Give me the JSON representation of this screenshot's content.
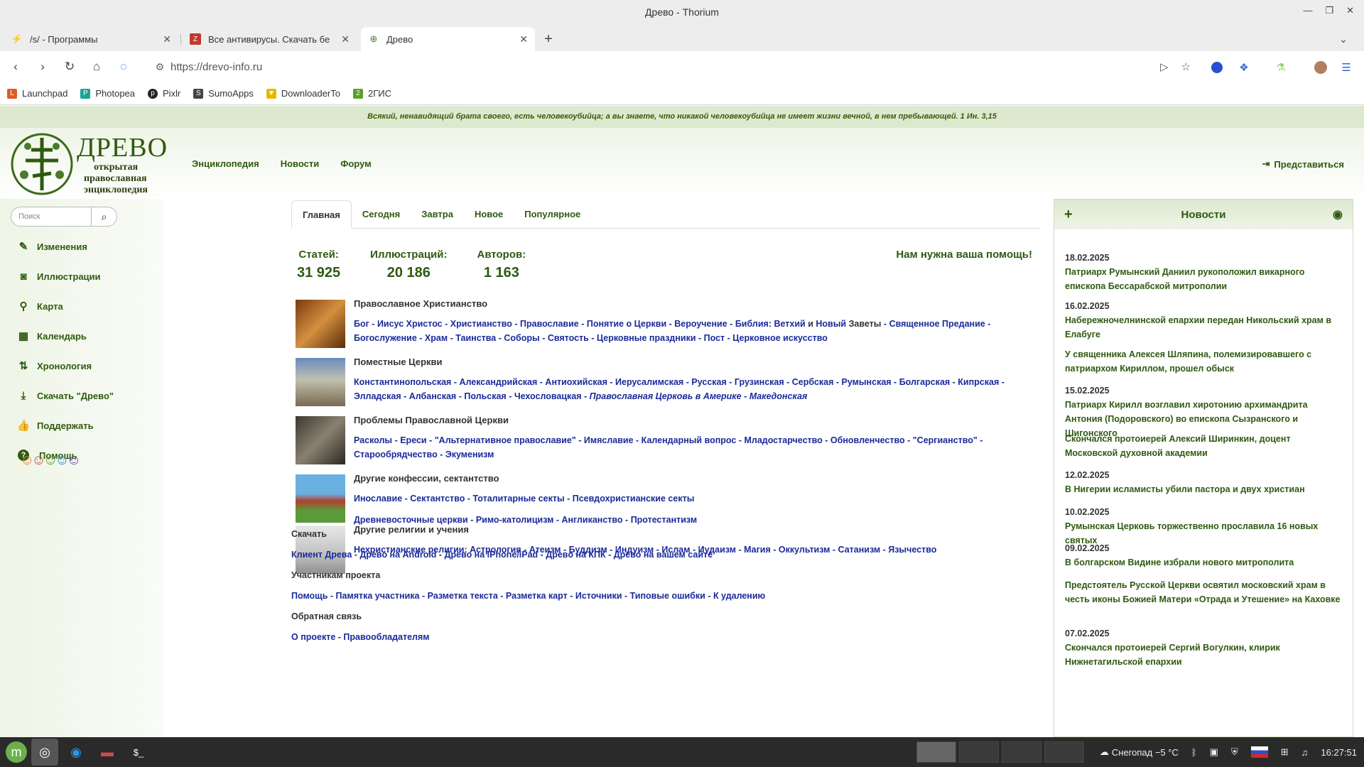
{
  "window": {
    "title": "Древо - Thorium"
  },
  "tabs": [
    {
      "label": "/s/ - Программы",
      "icon": "lightning-icon",
      "color": "#e8833a"
    },
    {
      "label": "Все антивирусы. Скачать бе",
      "icon": "antivirus-site-icon",
      "color": "#c0392b"
    },
    {
      "label": "Древо",
      "icon": "drevo-icon",
      "color": "#4a7a2a"
    }
  ],
  "url": "https://drevo-info.ru",
  "bookmarks": [
    {
      "label": "Launchpad",
      "color": "#e05a2a"
    },
    {
      "label": "Photopea",
      "color": "#18a497"
    },
    {
      "label": "Pixlr",
      "color": "#222"
    },
    {
      "label": "SumoApps",
      "color": "#333"
    },
    {
      "label": "DownloaderTo",
      "color": "#e6b800"
    },
    {
      "label": "2ГИС",
      "color": "#5aa02c"
    }
  ],
  "page": {
    "quote": "Всякий, ненавидящий брата своего, есть человекоубийца; а вы знаете, что никакой человекоубийца не имеет жизни вечной, в нем пребывающей. 1 Ин. 3,15",
    "logo": {
      "title": "ДРЕВО",
      "sub1": "открытая",
      "sub2": "православная",
      "sub3": "энциклопедия"
    },
    "nav": [
      "Энциклопедия",
      "Новости",
      "Форум"
    ],
    "login": "Представиться",
    "search_placeholder": "Поиск",
    "sidebar": [
      {
        "label": "Изменения",
        "icon": "pencil-icon"
      },
      {
        "label": "Иллюстрации",
        "icon": "camera-icon"
      },
      {
        "label": "Карта",
        "icon": "map-pin-icon"
      },
      {
        "label": "Календарь",
        "icon": "calendar-icon"
      },
      {
        "label": "Хронология",
        "icon": "sort-icon"
      },
      {
        "label": "Скачать \"Древо\"",
        "icon": "download-icon"
      },
      {
        "label": "Поддержать",
        "icon": "thumbs-up-icon"
      },
      {
        "label": "Помощь",
        "icon": "help-icon"
      }
    ],
    "main_tabs": [
      "Главная",
      "Сегодня",
      "Завтра",
      "Новое",
      "Популярное"
    ],
    "stats": [
      {
        "label": "Статей:",
        "value": "31 925"
      },
      {
        "label": "Иллюстраций:",
        "value": "20 186"
      },
      {
        "label": "Авторов:",
        "value": "1 163"
      }
    ],
    "help": "Нам нужна ваша помощь!",
    "sections": [
      {
        "title": "Православное Христианство",
        "links": [
          "Бог",
          "Иисус Христос",
          "Христианство",
          "Православие",
          "Понятие о Церкви",
          "Вероучение",
          "Библия: Ветхий",
          "и",
          "Новый",
          "Заветы",
          "Священное Предание",
          "Богослужение",
          "Храм",
          "Таинства",
          "Соборы",
          "Святость",
          "Церковные праздники",
          "Пост",
          "Церковное искусство"
        ]
      },
      {
        "title": "Поместные Церкви",
        "links": [
          "Константинопольская",
          "Александрийская",
          "Антиохийская",
          "Иерусалимская",
          "Русская",
          "Грузинская",
          "Сербская",
          "Румынская",
          "Болгарская",
          "Кипрская",
          "Элладская",
          "Албанская",
          "Польская",
          "Чехословацкая"
        ],
        "italic_links": [
          "Православная Церковь в Америке",
          "Македонская"
        ]
      },
      {
        "title": "Проблемы Православной Церкви",
        "links": [
          "Расколы",
          "Ереси",
          "\"Альтернативное православие\"",
          "Имяславие",
          "Календарный вопрос",
          "Младостарчество",
          "Обновленчество",
          "\"Сергианство\"",
          "Старообрядчество",
          "Экуменизм"
        ]
      },
      {
        "title": "Другие конфессии, сектантство",
        "links": [
          "Инославие",
          "Сектантство",
          "Тоталитарные секты",
          "Псевдохристианские секты"
        ],
        "links2": [
          "Древневосточные церкви",
          "Римо-католицизм",
          "Англиканство",
          "Протестантизм"
        ]
      },
      {
        "title": "Другие религии и учения",
        "links": [
          "Нехристианские религии:",
          "Астрология",
          "Атеизм",
          "Буддизм",
          "Индуизм",
          "Ислам",
          "Иудаизм",
          "Магия",
          "Оккультизм",
          "Сатанизм",
          "Язычество"
        ]
      }
    ],
    "lower": [
      {
        "title": "Скачать",
        "links": [
          "Клиент Древа",
          "Древо на Android",
          "Древо на iPhone/iPad",
          "Древо на КПК",
          "Древо на вашем сайте"
        ]
      },
      {
        "title": "Участникам проекта",
        "links": [
          "Помощь",
          "Памятка участника",
          "Разметка текста",
          "Разметка карт",
          "Источники",
          "Типовые ошибки",
          "К удалению"
        ]
      },
      {
        "title": "Обратная связь",
        "links": [
          "О проекте",
          "Правообладателям"
        ]
      }
    ],
    "news": {
      "title": "Новости",
      "items": [
        {
          "date": "18.02.2025",
          "text": "Патриарх Румынский Даниил рукоположил викарного епископа Бессарабской митрополии"
        },
        {
          "date": "16.02.2025",
          "text": "Набережночелнинской епархии передан Никольский храм в Елабуге"
        },
        {
          "date": "",
          "text": "У священника Алексея Шляпина, полемизировавшего с патриархом Кириллом, прошел обыск"
        },
        {
          "date": "15.02.2025",
          "text": "Патриарх Кирилл возглавил хиротонию архимандрита Антония (Подоровского) во епископа Сызранского и Шигонского"
        },
        {
          "date": "",
          "text": "Скончался протоиерей Алексий Ширинкин, доцент Московской духовной академии"
        },
        {
          "date": "12.02.2025",
          "text": "В Нигерии исламисты убили пастора и двух христиан"
        },
        {
          "date": "10.02.2025",
          "text": "Румынская Церковь торжественно прославила 16 новых святых"
        },
        {
          "date": "09.02.2025",
          "text": "В болгарском Видине избрали нового митрополита"
        },
        {
          "date": "",
          "text": "Предстоятель Русской Церкви освятил московский храм в честь иконы Божией Матери «Отрада и Утешение» на Каховке"
        },
        {
          "date": "07.02.2025",
          "text": "Скончался протоиерей Сергий Вогулкин, клирик Нижнетагильской епархии"
        }
      ]
    }
  },
  "taskbar": {
    "weather": "Снегопад −5 °C",
    "time": "16:27:51"
  }
}
